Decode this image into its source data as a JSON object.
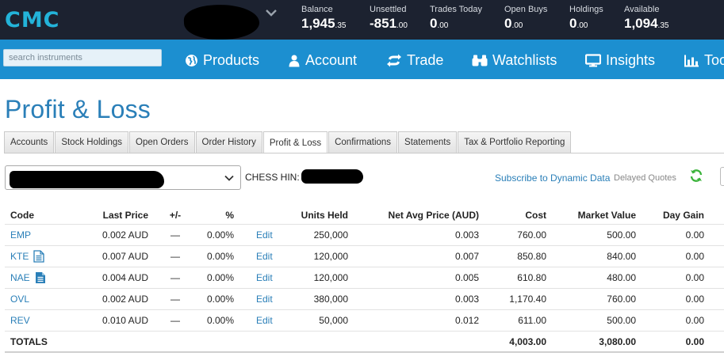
{
  "brand": {
    "logo": "CMC",
    "color": "#23b3d9"
  },
  "topbar": {
    "stats": [
      {
        "label": "Balance",
        "main": "1,945",
        "cents": ".35"
      },
      {
        "label": "Unsettled",
        "main": "-851",
        "cents": ".00"
      },
      {
        "label": "Trades Today",
        "main": "0",
        "cents": ".00"
      },
      {
        "label": "Open Buys",
        "main": "0",
        "cents": ".00"
      },
      {
        "label": "Holdings",
        "main": "0",
        "cents": ".00"
      },
      {
        "label": "Available",
        "main": "1,094",
        "cents": ".35"
      }
    ]
  },
  "nav": {
    "search_placeholder": "search instruments",
    "items": [
      {
        "label": "Products",
        "icon": "globe-icon"
      },
      {
        "label": "Account",
        "icon": "user-icon"
      },
      {
        "label": "Trade",
        "icon": "swap-arrows-icon"
      },
      {
        "label": "Watchlists",
        "icon": "binoculars-icon"
      },
      {
        "label": "Insights",
        "icon": "monitor-icon"
      },
      {
        "label": "Too",
        "icon": "bar-chart-icon"
      }
    ]
  },
  "page": {
    "title": "Profit & Loss"
  },
  "tabs": [
    {
      "label": "Accounts",
      "active": false
    },
    {
      "label": "Stock Holdings",
      "active": false
    },
    {
      "label": "Open Orders",
      "active": false
    },
    {
      "label": "Order History",
      "active": false
    },
    {
      "label": "Profit & Loss",
      "active": true
    },
    {
      "label": "Confirmations",
      "active": false
    },
    {
      "label": "Statements",
      "active": false
    },
    {
      "label": "Tax & Portfolio Reporting",
      "active": false
    }
  ],
  "filters": {
    "chess_label": "CHESS HIN:",
    "subscribe_link": "Subscribe to Dynamic Data",
    "delayed_label": "Delayed Quotes"
  },
  "table": {
    "headers": {
      "code": "Code",
      "last": "Last Price",
      "pm": "+/-",
      "pct": "%",
      "units": "Units Held",
      "navg": "Net Avg Price (AUD)",
      "cost": "Cost",
      "mv": "Market Value",
      "dg": "Day Gain"
    },
    "rows": [
      {
        "code": "EMP",
        "doc": "none",
        "last": "0.002 AUD",
        "pm": "—",
        "pct": "0.00%",
        "edit": "Edit",
        "units": "250,000",
        "navg": "0.003",
        "cost": "760.00",
        "mv": "500.00",
        "dg": "0.00"
      },
      {
        "code": "KTE",
        "doc": "outline",
        "last": "0.007 AUD",
        "pm": "—",
        "pct": "0.00%",
        "edit": "Edit",
        "units": "120,000",
        "navg": "0.007",
        "cost": "850.80",
        "mv": "840.00",
        "dg": "0.00"
      },
      {
        "code": "NAE",
        "doc": "filled",
        "last": "0.004 AUD",
        "pm": "—",
        "pct": "0.00%",
        "edit": "Edit",
        "units": "120,000",
        "navg": "0.005",
        "cost": "610.80",
        "mv": "480.00",
        "dg": "0.00"
      },
      {
        "code": "OVL",
        "doc": "none",
        "last": "0.002 AUD",
        "pm": "—",
        "pct": "0.00%",
        "edit": "Edit",
        "units": "380,000",
        "navg": "0.003",
        "cost": "1,170.40",
        "mv": "760.00",
        "dg": "0.00"
      },
      {
        "code": "REV",
        "doc": "none",
        "last": "0.010 AUD",
        "pm": "—",
        "pct": "0.00%",
        "edit": "Edit",
        "units": "50,000",
        "navg": "0.012",
        "cost": "611.00",
        "mv": "500.00",
        "dg": "0.00"
      }
    ],
    "totals": {
      "label": "TOTALS",
      "cost": "4,003.00",
      "mv": "3,080.00",
      "dg": "0.00"
    }
  }
}
